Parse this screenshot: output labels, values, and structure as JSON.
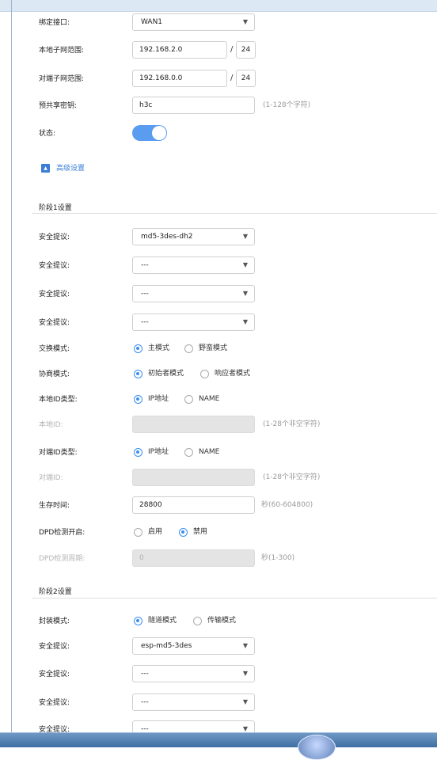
{
  "basic": {
    "bind_interface": {
      "label": "绑定接口:",
      "value": "WAN1"
    },
    "local_subnet": {
      "label": "本地子网范围:",
      "ip": "192.168.2.0",
      "mask": "24"
    },
    "peer_subnet": {
      "label": "对端子网范围:",
      "ip": "192.168.0.0",
      "mask": "24"
    },
    "psk": {
      "label": "预共享密钥:",
      "value": "h3c",
      "hint": "(1-128个字符)"
    },
    "status": {
      "label": "状态:"
    },
    "advanced_link": "高级设置",
    "slash": "/"
  },
  "phase1": {
    "title": "阶段1设置",
    "proposals": [
      {
        "label": "安全提议:",
        "value": "md5-3des-dh2"
      },
      {
        "label": "安全提议:",
        "value": "---"
      },
      {
        "label": "安全提议:",
        "value": "---"
      },
      {
        "label": "安全提议:",
        "value": "---"
      }
    ],
    "exchange_mode": {
      "label": "交换模式:",
      "opt1": "主模式",
      "opt2": "野蛮模式"
    },
    "negotiate_mode": {
      "label": "协商模式:",
      "opt1": "初始者模式",
      "opt2": "响应者模式"
    },
    "local_id_type": {
      "label": "本地ID类型:",
      "opt1": "IP地址",
      "opt2": "NAME"
    },
    "local_id": {
      "label": "本地ID:",
      "hint": "(1-28个非空字符)"
    },
    "peer_id_type": {
      "label": "对端ID类型:",
      "opt1": "IP地址",
      "opt2": "NAME"
    },
    "peer_id": {
      "label": "对端ID:",
      "hint": "(1-28个非空字符)"
    },
    "lifetime": {
      "label": "生存时间:",
      "value": "28800",
      "hint": "秒(60-604800)"
    },
    "dpd_enable": {
      "label": "DPD检测开启:",
      "opt1": "启用",
      "opt2": "禁用"
    },
    "dpd_period": {
      "label": "DPD检测周期:",
      "value": "0",
      "hint": "秒(1-300)"
    }
  },
  "phase2": {
    "title": "阶段2设置",
    "encap_mode": {
      "label": "封装模式:",
      "opt1": "隧道模式",
      "opt2": "传输模式"
    },
    "proposals": [
      {
        "label": "安全提议:",
        "value": "esp-md5-3des"
      },
      {
        "label": "安全提议:",
        "value": "---"
      },
      {
        "label": "安全提议:",
        "value": "---"
      },
      {
        "label": "安全提议:",
        "value": "---"
      }
    ]
  },
  "icons": {
    "dropdown": "▼",
    "collapse": "▲"
  },
  "colors": {
    "accent": "#3a7fd5",
    "toggle_on": "#5a9cf0",
    "disabled_bg": "#e4e4e4"
  }
}
